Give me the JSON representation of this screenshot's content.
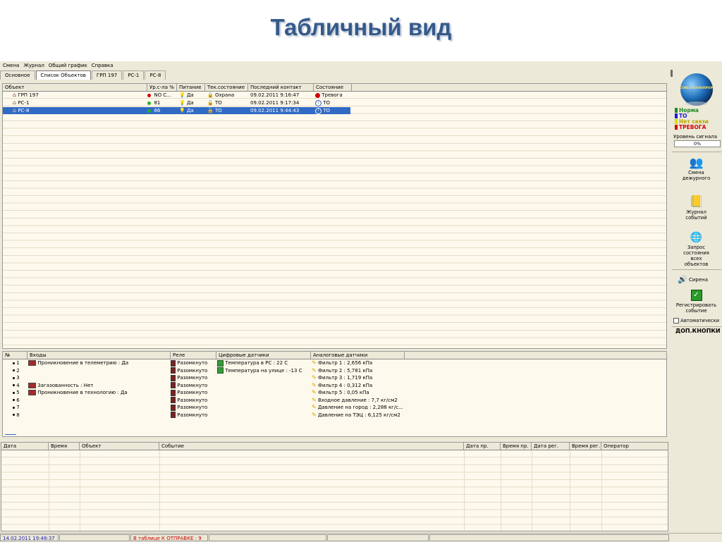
{
  "slide_title": "Табличный вид",
  "menu": [
    "Смена",
    "Журнал",
    "Общий график",
    "Справка"
  ],
  "tabs": [
    "Основное",
    "Список Объектов",
    "ГРП 197",
    "РС-1",
    "РС-8"
  ],
  "objects_table": {
    "headers": [
      "Объект",
      "Ур.с-ла %",
      "Питание",
      "Тек.состояние",
      "Последний контакт",
      "Состояние"
    ],
    "rows": [
      {
        "name": "ГРП 197",
        "level": "NO C...",
        "power": "Да",
        "state": "Охрана",
        "contact": "09.02.2011  9:16:47",
        "status": "Тревога",
        "dot": "#d40000",
        "status_icon": "stop-icon"
      },
      {
        "name": "РС-1",
        "level": "81",
        "power": "Да",
        "state": "ТО",
        "contact": "09.02.2011  9:17:34",
        "status": "ТО",
        "dot": "#27b427",
        "status_icon": "info-icon"
      },
      {
        "name": "РС-8",
        "level": "66",
        "power": "Да",
        "state": "ТО",
        "contact": "09.02.2011  9:44:43",
        "status": "ТО",
        "dot": "#27b427",
        "status_icon": "info-icon"
      }
    ]
  },
  "io_table": {
    "headers": [
      "№",
      "Входы",
      "Реле",
      "Цифровые датчики",
      "Аналоговые датчики"
    ],
    "rows": [
      {
        "n": "1",
        "input": "Проникновение в телеметрию : Да",
        "relay": "Разомкнуто",
        "digital": "Температура в РС : 22 С",
        "analog": "Фильтр 1 : 2,656 кПа"
      },
      {
        "n": "2",
        "input": "",
        "relay": "Разомкнуто",
        "digital": "Температура на улице : -13 С",
        "analog": "Фильтр 2 : 5,781 кПа"
      },
      {
        "n": "3",
        "input": "",
        "relay": "Разомкнуто",
        "digital": "",
        "analog": "Фильтр 3 : 1,719 кПа"
      },
      {
        "n": "4",
        "input": "Загазованность : Нет",
        "relay": "Разомкнуто",
        "digital": "",
        "analog": "Фильтр 4 : 0,312 кПа"
      },
      {
        "n": "5",
        "input": "Проникновение в технологию : Да",
        "relay": "Разомкнуто",
        "digital": "",
        "analog": "Фильтр 5 : 0,05 кПа"
      },
      {
        "n": "6",
        "input": "",
        "relay": "Разомкнуто",
        "digital": "",
        "analog": "Входное давление : 7,7 кг/см2"
      },
      {
        "n": "7",
        "input": "",
        "relay": "Разомкнуто",
        "digital": "",
        "analog": "Давление на город : 2,288 кг/с..."
      },
      {
        "n": "8",
        "input": "",
        "relay": "Разомкнуто",
        "digital": "",
        "analog": "Давление  на ТЭЦ : 6,125 кг/см2"
      }
    ]
  },
  "events_table": {
    "headers": [
      "Дата",
      "Время",
      "Объект",
      "Событие",
      "Дата пр.",
      "Время пр.",
      "Дата рег.",
      "Время рег.",
      "Оператор"
    ]
  },
  "sidebar": {
    "logo_text": "СОЮЗТЕХНОПРОМ",
    "legend": [
      {
        "label": "Норма",
        "color": "#1f8a1f"
      },
      {
        "label": "ТО",
        "color": "#1a1ad4"
      },
      {
        "label": "Нет связи",
        "color": "#b8a800"
      },
      {
        "label": "ТРЕВОГА",
        "color": "#d40000"
      }
    ],
    "signal_label": "Уровень сигнала",
    "signal_value": "0%",
    "shift_button": "Смена дежурного",
    "journal_button": "Журнал событий",
    "query_button": "Запрос состояния всех объектов",
    "siren_button": "Сирена",
    "register_button": "Регистрировать событие",
    "auto_checkbox": "Автоматически",
    "extra_buttons": "ДОП.КНОПКИ"
  },
  "status_bar": {
    "datetime": "14.02.2011  19:48:37",
    "queue": "В таблице К ОТПРАВКЕ : 9"
  }
}
